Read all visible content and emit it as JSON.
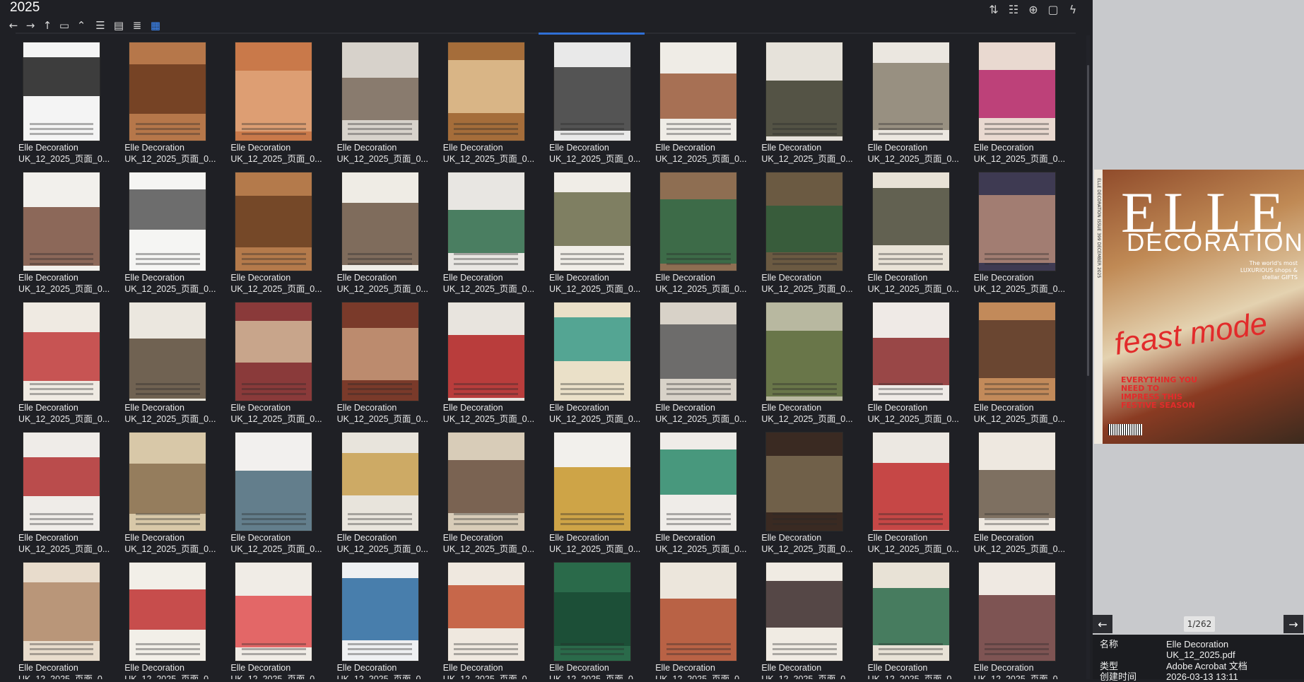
{
  "header": {
    "folder_title": "2025",
    "nav": {
      "back_icon": "arrow-left-icon",
      "forward_icon": "arrow-right-icon",
      "up_icon": "arrow-up-icon",
      "folder_icon": "folder-icon",
      "expand_icon": "chevron-up-icon"
    },
    "view_modes": [
      {
        "icon": "list-view-icon",
        "active": false
      },
      {
        "icon": "detail-view-icon",
        "active": false
      },
      {
        "icon": "tree-view-icon",
        "active": false
      },
      {
        "icon": "grid-view-icon",
        "active": true
      }
    ],
    "tools": [
      "sort-icon",
      "filter-icon",
      "add-circle-icon",
      "clipboard-icon",
      "lightning-icon"
    ]
  },
  "thumbnails": {
    "label_line1": "Elle Decoration",
    "label_line2": "UK_12_2025_页面_0...",
    "count": 50
  },
  "preview": {
    "cover": {
      "spine_text": "ELLE DECORATION   ISSUE 399   DECEMBER 2025",
      "masthead": "ELLE",
      "sub": "DECORATION",
      "tag": "The world's most LUXURIOUS shops & stellar GIFTS",
      "headline": "feast mode",
      "deck": "EVERYTHING YOU NEED TO IMPRESS THIS FESTIVE SEASON"
    },
    "page_indicator": "1/262",
    "prev_icon": "arrow-left-icon",
    "next_icon": "arrow-right-icon"
  },
  "info": {
    "name_label": "名称",
    "name_value_1": "Elle Decoration",
    "name_value_2": "UK_12_2025.pdf",
    "type_label": "类型",
    "type_value": "Adobe Acrobat 文档",
    "created_label": "创建时间",
    "created_value": "2026-03-13  13:11"
  },
  "colors": {
    "background": "#1f2025",
    "accent": "#3d8cff",
    "preview_bg": "#c8c9cc",
    "cover_red": "#e22b2b"
  }
}
